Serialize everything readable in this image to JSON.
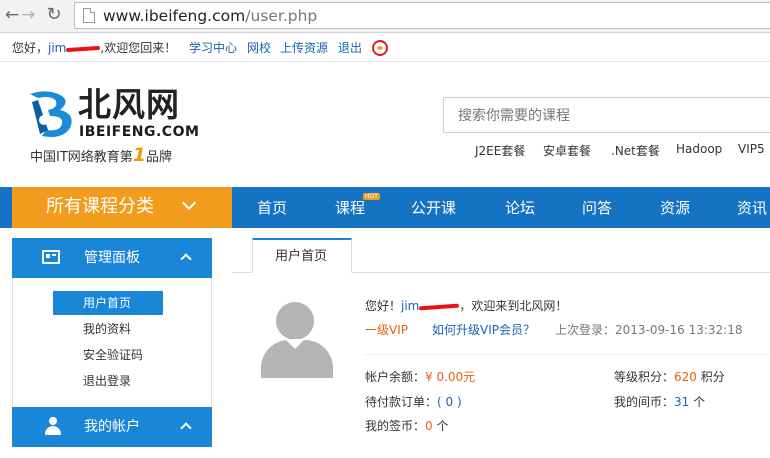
{
  "browser": {
    "url_host": "www.ibeifeng.com",
    "url_path": "/user.php"
  },
  "topbar": {
    "greeting_prefix": "您好，",
    "username": "jim",
    "greeting_suffix": ",欢迎您回来！",
    "links": [
      "学习中心",
      "网校",
      "上传资源",
      "退出"
    ]
  },
  "header": {
    "logo_cn": "北风网",
    "logo_en": "IBEIFENG.COM",
    "slogan_prefix": "中国IT网络教育第",
    "slogan_num": "1",
    "slogan_suffix": "品牌",
    "search_placeholder": "搜索你需要的课程",
    "hot_links": [
      "J2EE套餐",
      "安卓套餐",
      ".Net套餐",
      "Hadoop",
      "VIP5"
    ]
  },
  "nav": {
    "category_label": "所有课程分类",
    "items": [
      "首页",
      "课程",
      "公开课",
      "论坛",
      "问答",
      "资源",
      "资讯"
    ],
    "hot_badge": "HOT"
  },
  "sidebar": {
    "panel_title": "管理面板",
    "items": [
      "用户首页",
      "我的资料",
      "安全验证码",
      "退出登录"
    ],
    "account_title": "我的帐户"
  },
  "main": {
    "tab": "用户首页",
    "welcome_prefix": "您好！",
    "username": "jim",
    "welcome_suffix": "，欢迎来到北风网！",
    "vip_level": "一级VIP",
    "upgrade_link": "如何升级VIP会员？",
    "last_login_label": "上次登录：",
    "last_login": "2013-09-16 13:32:18",
    "balance_label": "帐户余额：",
    "balance": "¥ 0.00元",
    "points_label": "等级积分：",
    "points": "620",
    "points_unit": " 积分",
    "pending_label": "待付款订单：",
    "pending": "( 0 )",
    "coins_label": "我的间币：",
    "coins": "31",
    "coins_unit": " 个",
    "sign_label": "我的签币：",
    "sign": "0",
    "sign_unit": " 个"
  },
  "colors": {
    "nav_blue": "#1573c4",
    "sidebar_blue": "#1a86d8",
    "orange": "#f29c1e",
    "link_blue": "#1a62b4"
  }
}
